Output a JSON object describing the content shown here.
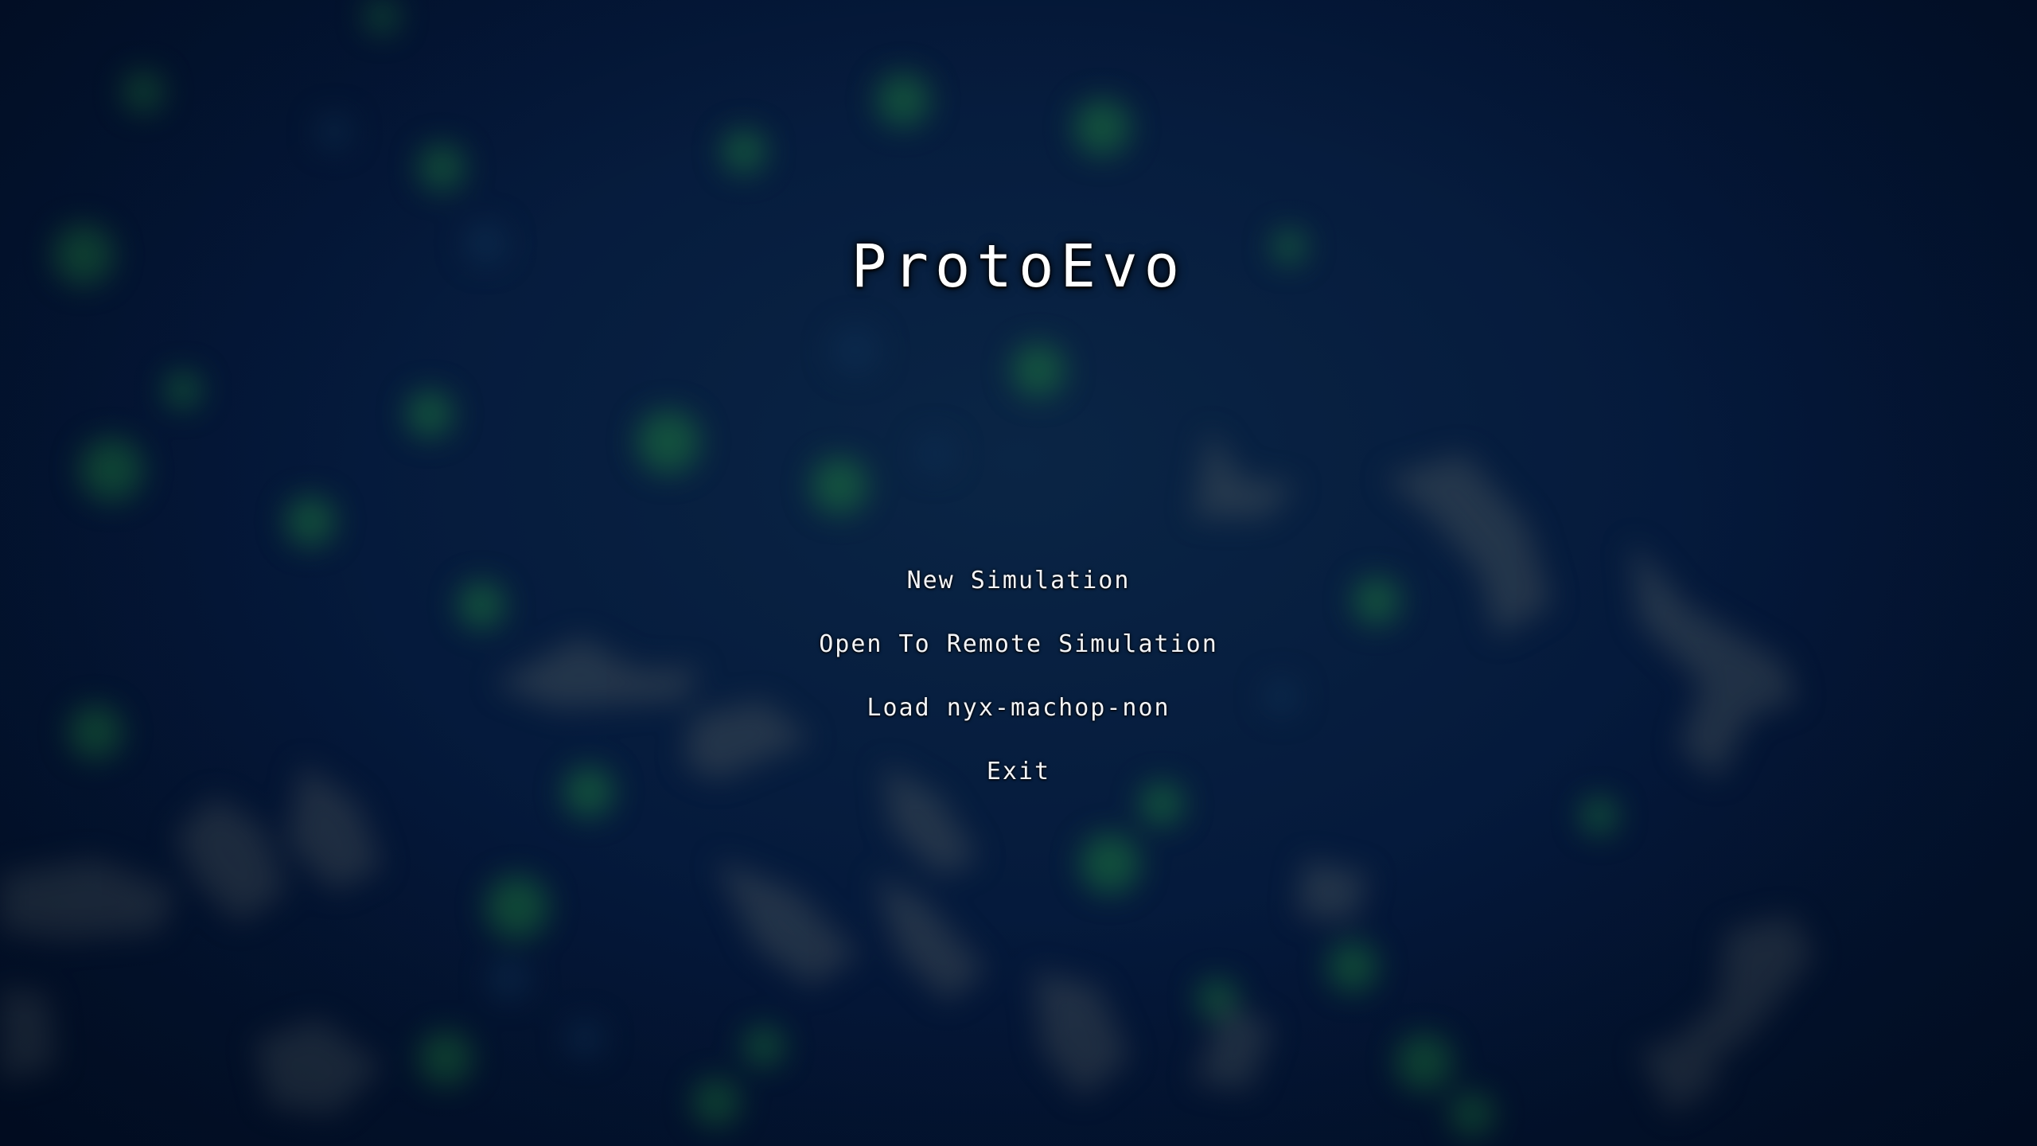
{
  "app": {
    "title": "ProtoEvo"
  },
  "menu": {
    "items": [
      {
        "label": "New Simulation"
      },
      {
        "label": "Open To Remote Simulation"
      },
      {
        "label": "Load nyx-machop-non"
      },
      {
        "label": "Exit"
      }
    ]
  },
  "colors": {
    "background": "#031630",
    "text": "#ffffff",
    "cell_green": "#1f7a3a",
    "cell_gray": "#3a4550"
  }
}
